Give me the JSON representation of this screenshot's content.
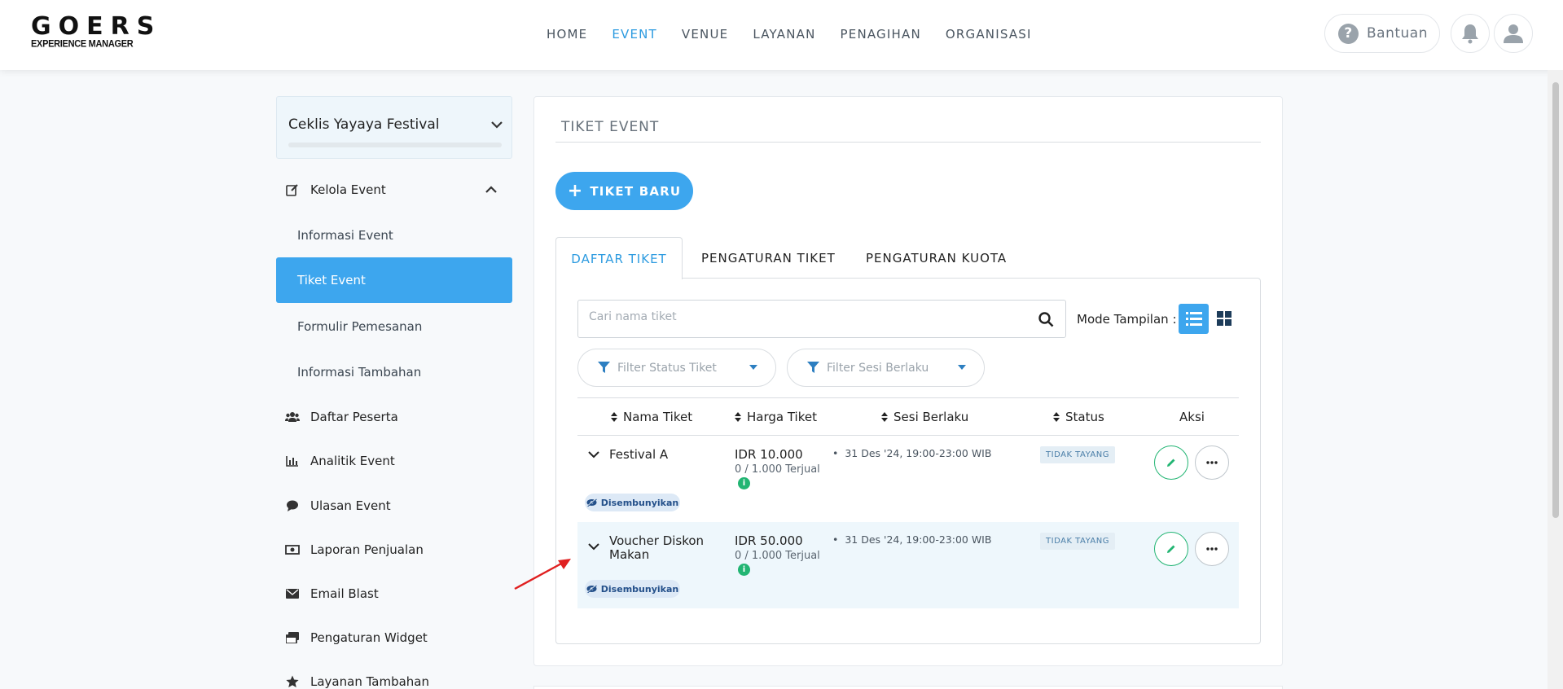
{
  "app": {
    "logo_line1": "GOERS",
    "logo_line2": "EXPERIENCE MANAGER"
  },
  "nav": {
    "items": [
      "HOME",
      "EVENT",
      "VENUE",
      "LAYANAN",
      "PENAGIHAN",
      "ORGANISASI"
    ],
    "active": "EVENT"
  },
  "header": {
    "help_label": "Bantuan"
  },
  "sidebar": {
    "event_name": "Ceklis Yayaya Festival",
    "kelola": "Kelola Event",
    "sub_items": [
      "Informasi Event",
      "Tiket Event",
      "Formulir Pemesanan",
      "Informasi Tambahan"
    ],
    "active_sub": "Tiket Event",
    "items": [
      "Daftar Peserta",
      "Analitik Event",
      "Ulasan Event",
      "Laporan Penjualan",
      "Email Blast",
      "Pengaturan Widget",
      "Layanan Tambahan"
    ]
  },
  "main": {
    "section_title": "TIKET EVENT",
    "new_button": "TIKET BARU",
    "tabs": [
      "DAFTAR TIKET",
      "PENGATURAN TIKET",
      "PENGATURAN KUOTA"
    ],
    "active_tab": "DAFTAR TIKET",
    "search_placeholder": "Cari nama tiket",
    "mode_label": "Mode Tampilan :",
    "filter_status": "Filter Status Tiket",
    "filter_sesi": "Filter Sesi Berlaku",
    "columns": [
      "Nama Tiket",
      "Harga Tiket",
      "Sesi Berlaku",
      "Status",
      "Aksi"
    ],
    "rows": [
      {
        "name": "Festival A",
        "price": "IDR 10.000",
        "sold": "0 / 1.000 Terjual",
        "sesi": "31 Des '24, 19:00-23:00 WIB",
        "status": "TIDAK TAYANG",
        "badge": "Disembunyikan"
      },
      {
        "name_line1": "Voucher Diskon",
        "name_line2": "Makan",
        "price": "IDR 50.000",
        "sold": "0 / 1.000 Terjual",
        "sesi": "31 Des '24, 19:00-23:00 WIB",
        "status": "TIDAK TAYANG",
        "badge": "Disembunyikan"
      }
    ]
  },
  "colors": {
    "accent": "#3da6ee",
    "nav_active": "#2d9be0",
    "success": "#22b573",
    "annotation_arrow": "#e02020"
  }
}
